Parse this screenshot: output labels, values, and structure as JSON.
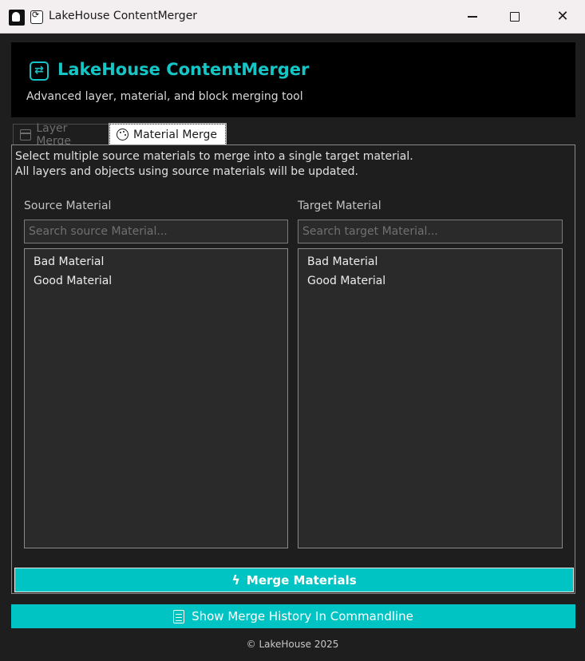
{
  "window": {
    "title": "LakeHouse ContentMerger"
  },
  "header": {
    "title": "LakeHouse ContentMerger",
    "subtitle": "Advanced layer, material, and block merging tool"
  },
  "tabs": [
    {
      "label": "Layer Merge",
      "icon": "calendar-icon",
      "active": false
    },
    {
      "label": "Material Merge",
      "icon": "palette-icon",
      "active": true
    }
  ],
  "material_merge": {
    "description_line1": "Select multiple source materials to merge into a single target material.",
    "description_line2": "All layers and objects using source materials will be updated.",
    "source": {
      "label": "Source Material",
      "placeholder": "Search source Material...",
      "items": [
        "Bad Material",
        "Good Material"
      ]
    },
    "target": {
      "label": "Target Material",
      "placeholder": "Search target Material...",
      "items": [
        "Bad Material",
        "Good Material"
      ]
    },
    "merge_button": "Merge Materials"
  },
  "history_button": "Show Merge History In Commandline",
  "footer": "© LakeHouse 2025",
  "colors": {
    "accent": "#00c4c4",
    "header_title": "#14c6c6",
    "background": "#1e1e1e"
  }
}
